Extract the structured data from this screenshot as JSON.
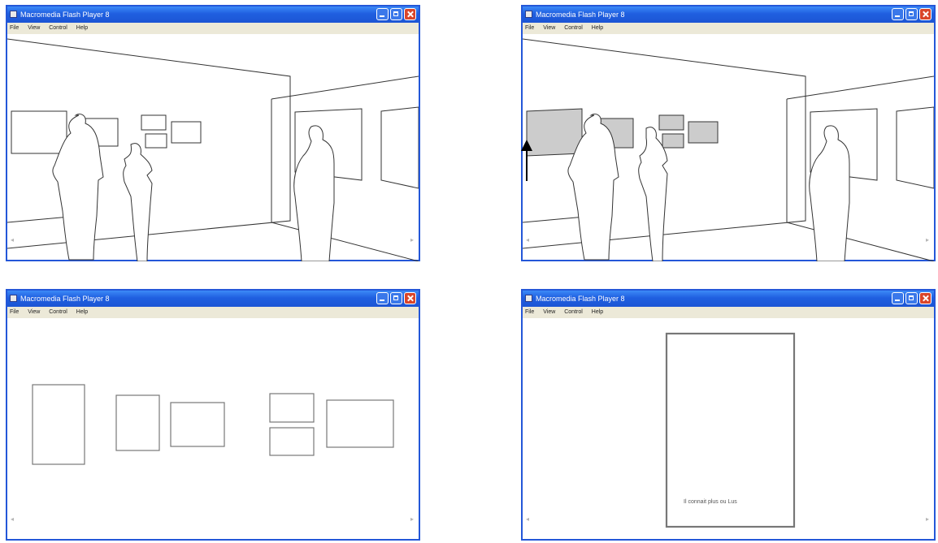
{
  "windows": [
    {
      "title": "Macromedia Flash Player 8",
      "menu": [
        "File",
        "View",
        "Control",
        "Help"
      ],
      "scene": "gallery-outline"
    },
    {
      "title": "Macromedia Flash Player 8",
      "menu": [
        "File",
        "View",
        "Control",
        "Help"
      ],
      "scene": "gallery-highlighted"
    },
    {
      "title": "Macromedia Flash Player 8",
      "menu": [
        "File",
        "View",
        "Control",
        "Help"
      ],
      "scene": "frames-only"
    },
    {
      "title": "Macromedia Flash Player 8",
      "menu": [
        "File",
        "View",
        "Control",
        "Help"
      ],
      "scene": "single-frame",
      "caption": "Il connait plus ou Lus"
    }
  ],
  "colors": {
    "title_bar": "#1f5fe0",
    "menu_bar": "#ece9d8",
    "highlight_fill": "#cccccc",
    "close_button": "#d9452a"
  },
  "icons": [
    "app-icon",
    "minimize-icon",
    "maximize-icon",
    "close-icon",
    "scroll-left-icon",
    "scroll-right-icon",
    "arrow-up-icon"
  ]
}
